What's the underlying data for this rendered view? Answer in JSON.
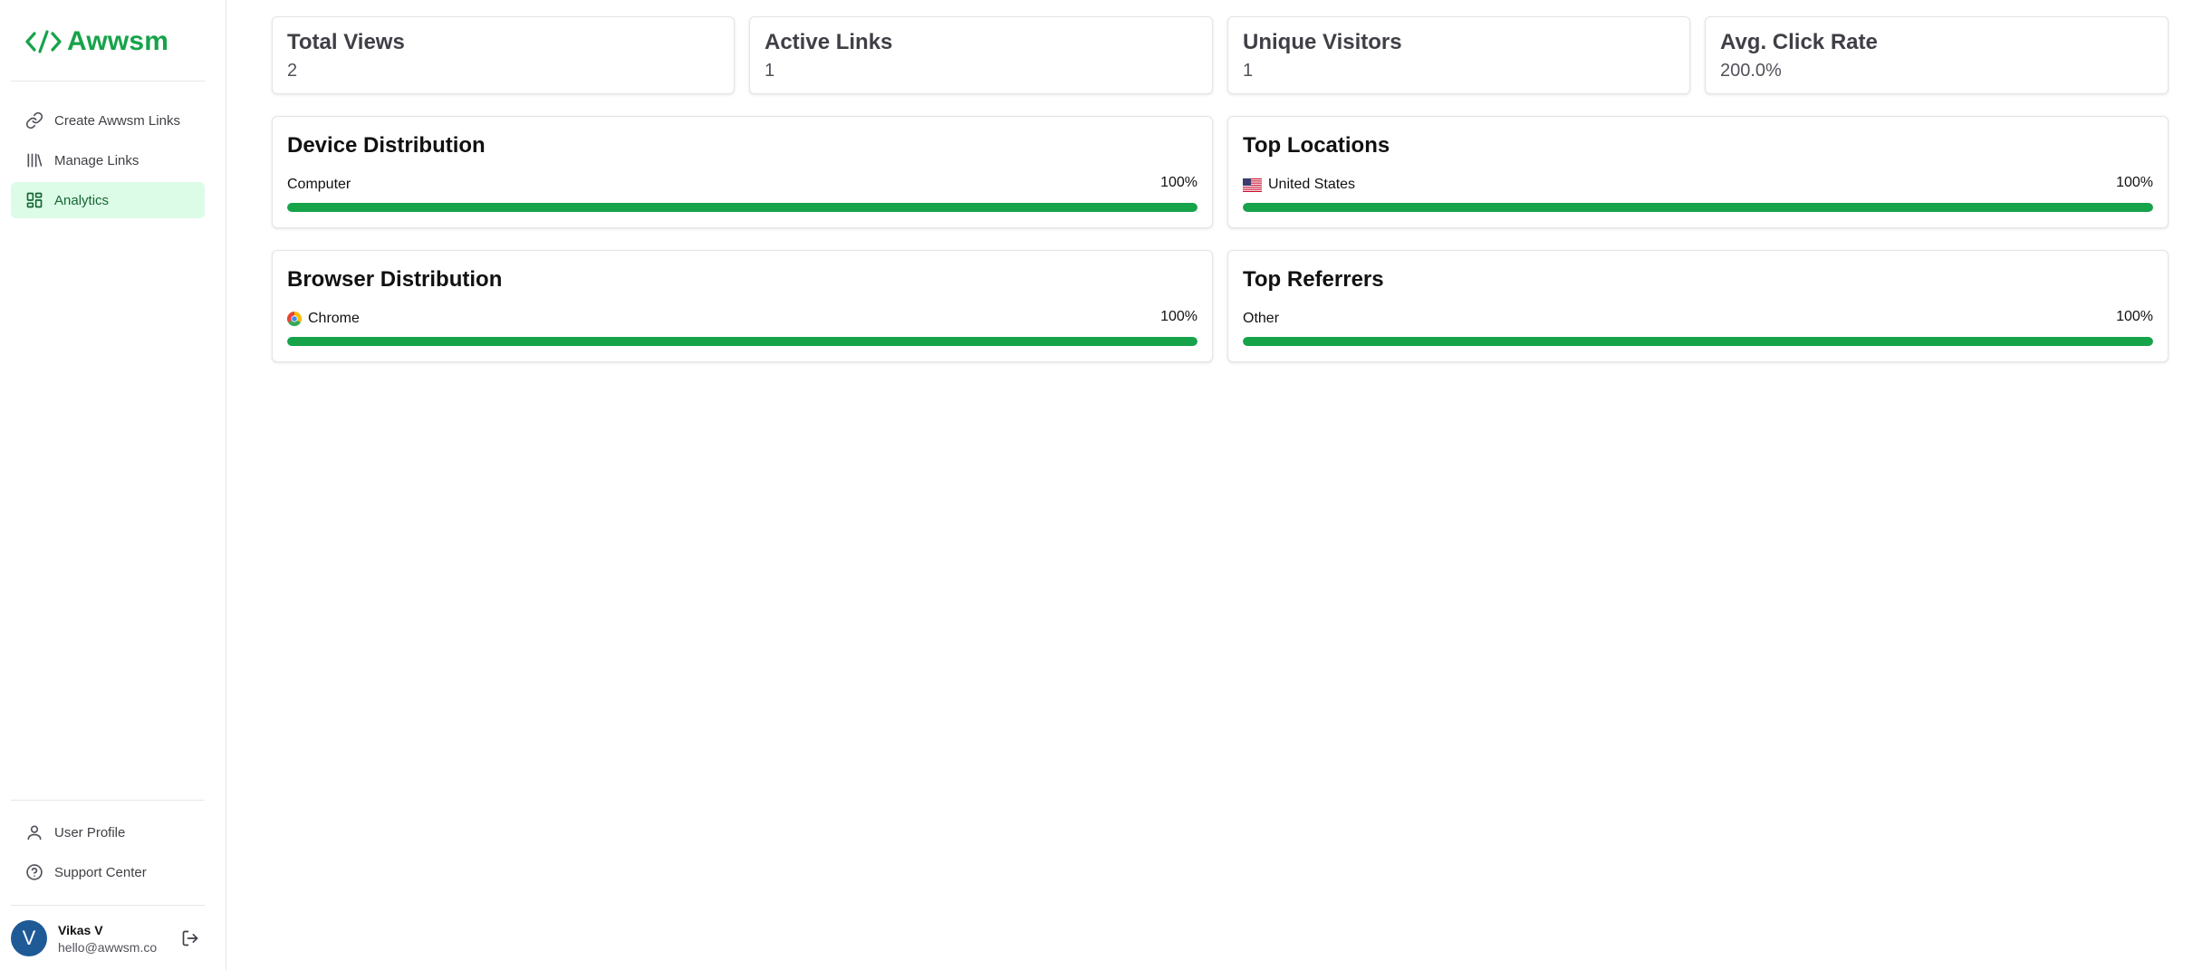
{
  "brand": {
    "name": "Awwsm",
    "icon": "code-brackets-icon",
    "color": "#16a34a"
  },
  "sidebar": {
    "items": [
      {
        "label": "Create Awwsm Links",
        "icon": "link-icon",
        "active": false
      },
      {
        "label": "Manage Links",
        "icon": "library-icon",
        "active": false
      },
      {
        "label": "Analytics",
        "icon": "dashboard-icon",
        "active": true
      }
    ],
    "bottom_items": [
      {
        "label": "User Profile",
        "icon": "user-icon"
      },
      {
        "label": "Support Center",
        "icon": "help-circle-icon"
      }
    ],
    "user": {
      "initial": "V",
      "name": "Vikas V",
      "email": "hello@awwsm.co"
    },
    "logout_icon": "logout-icon"
  },
  "stats": [
    {
      "title": "Total Views",
      "value": "2"
    },
    {
      "title": "Active Links",
      "value": "1"
    },
    {
      "title": "Unique Visitors",
      "value": "1"
    },
    {
      "title": "Avg. Click Rate",
      "value": "200.0%"
    }
  ],
  "device": {
    "title": "Device Distribution",
    "rows": [
      {
        "label": "Computer",
        "percent": "100%",
        "fraction": 1.0
      }
    ]
  },
  "locations": {
    "title": "Top Locations",
    "rows": [
      {
        "label": "United States",
        "icon": "us-flag-icon",
        "percent": "100%",
        "fraction": 1.0
      }
    ]
  },
  "browser": {
    "title": "Browser Distribution",
    "rows": [
      {
        "label": "Chrome",
        "icon": "chrome-icon",
        "percent": "100%",
        "fraction": 1.0
      }
    ]
  },
  "referrers": {
    "title": "Top Referrers",
    "rows": [
      {
        "label": "Other",
        "percent": "100%",
        "fraction": 1.0
      }
    ]
  },
  "colors": {
    "accent": "#16a34a",
    "active_nav_bg": "#dcfce7",
    "avatar_bg": "#1e5a96"
  }
}
